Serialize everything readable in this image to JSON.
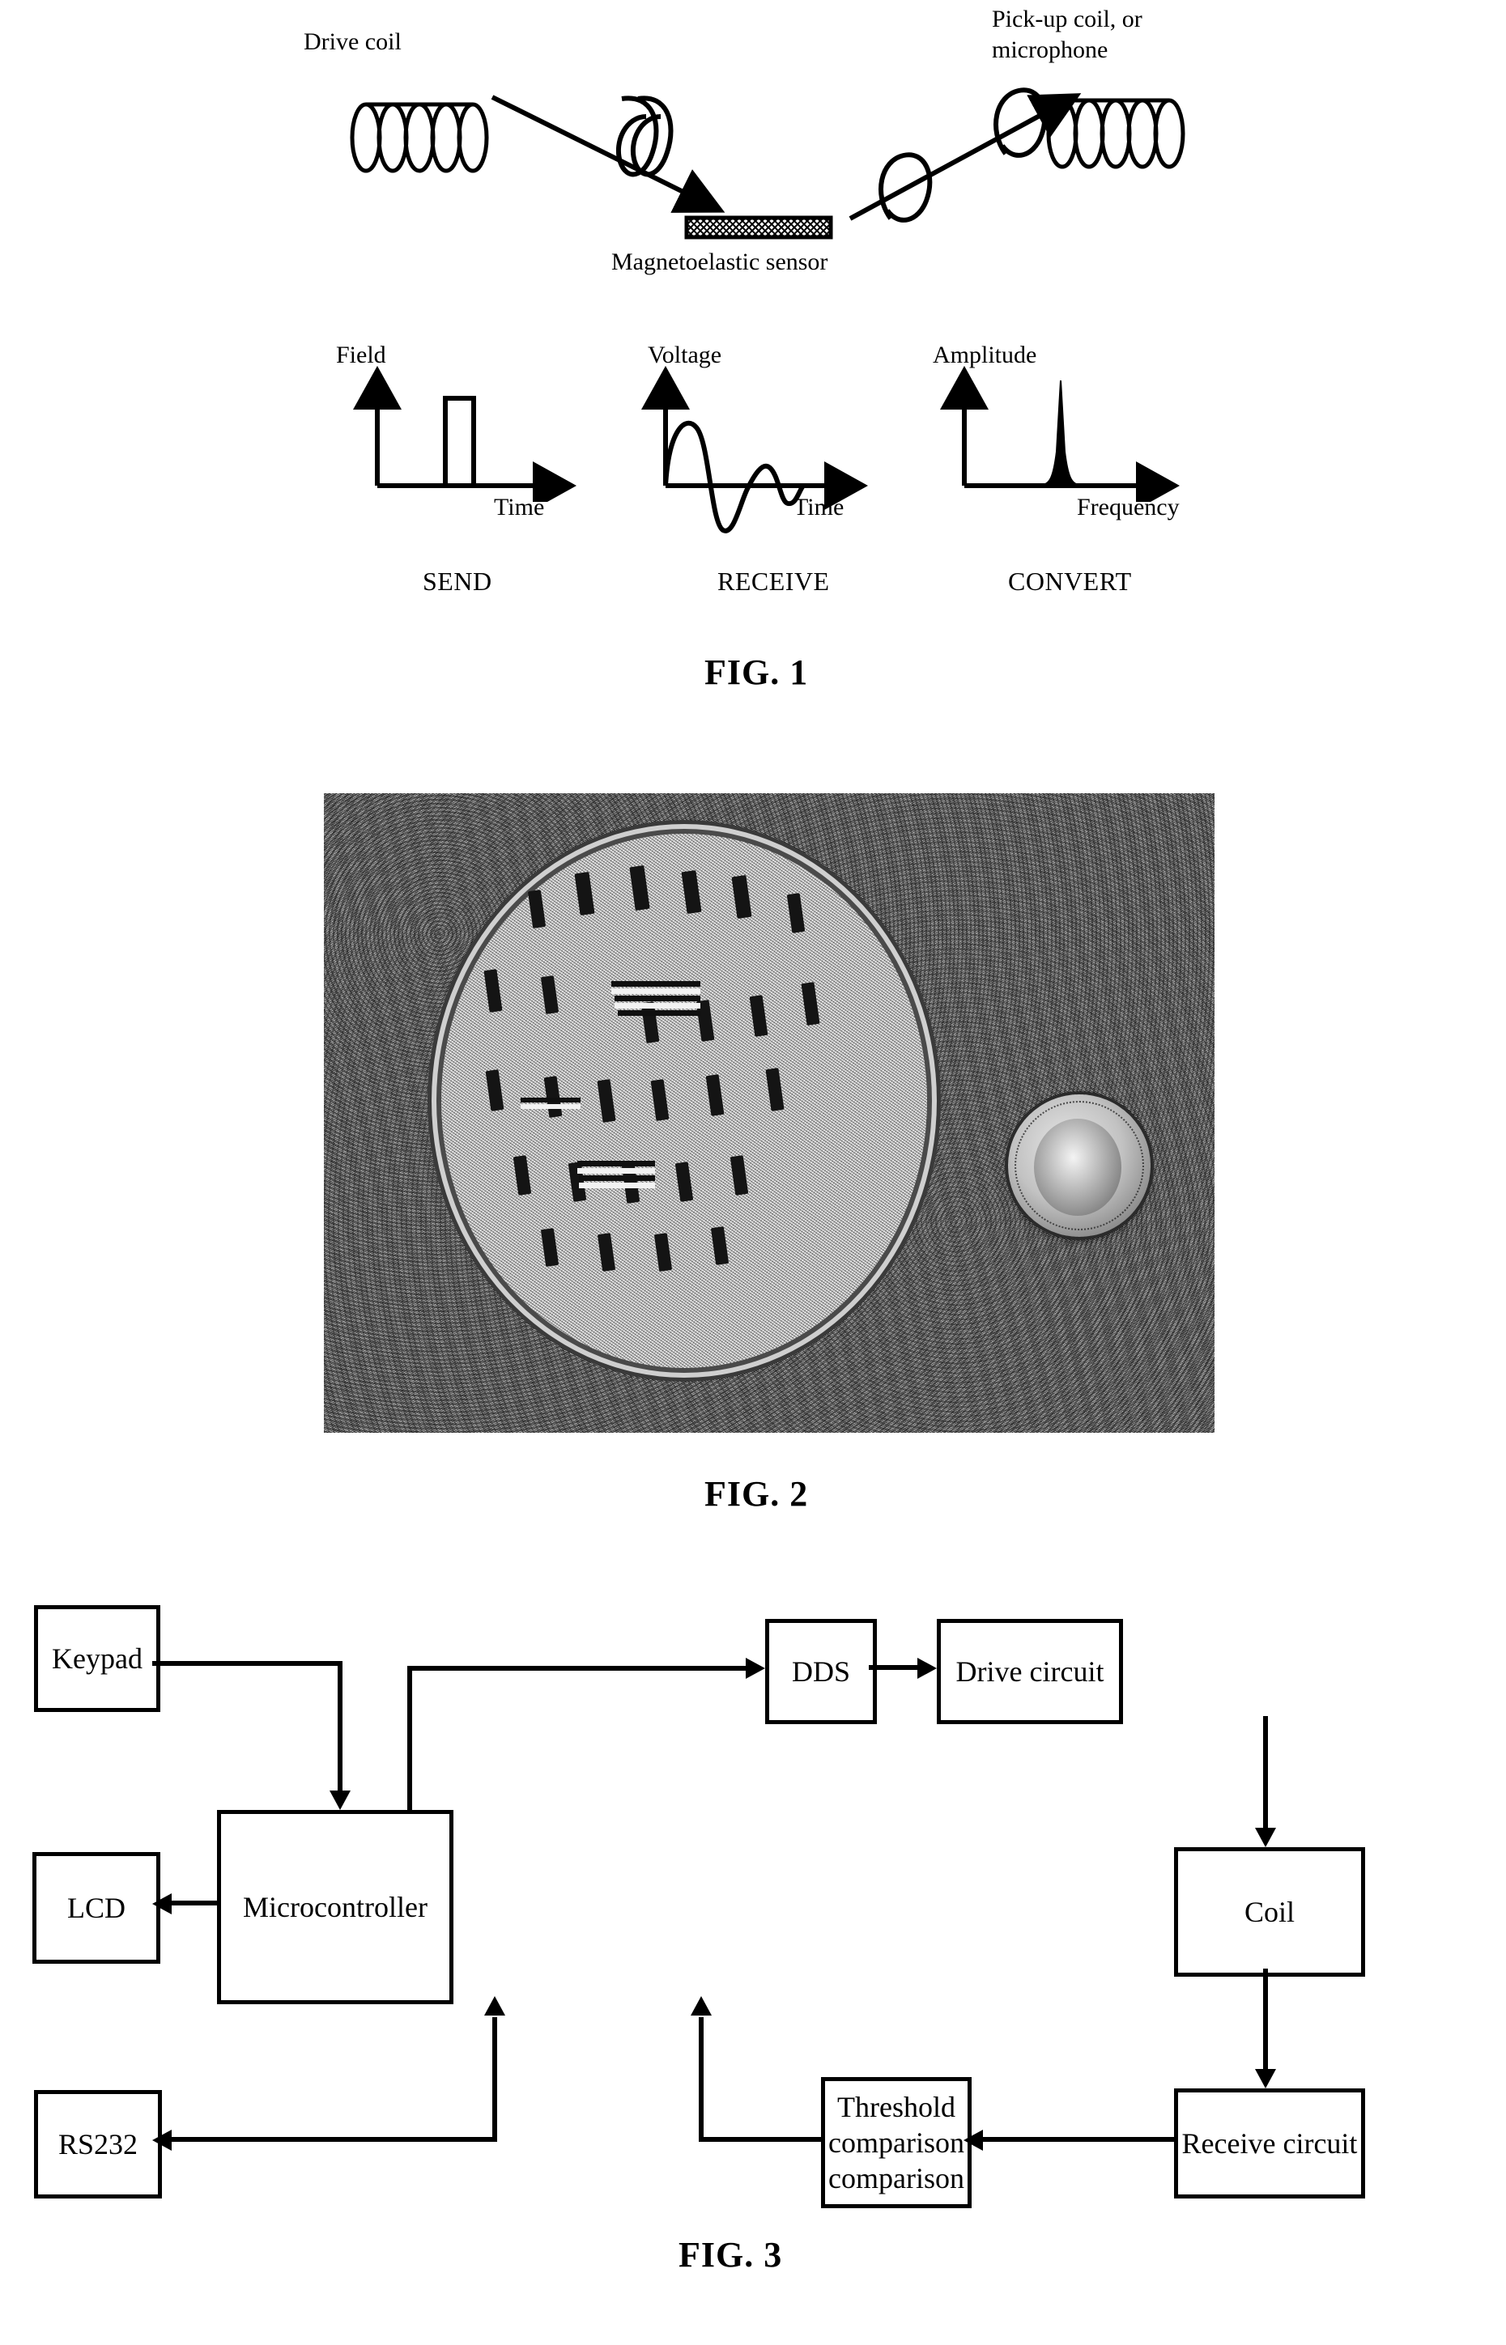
{
  "page": {
    "figures": [
      {
        "id": "fig1",
        "caption": "FIG. 1"
      },
      {
        "id": "fig2",
        "caption": "FIG. 2"
      },
      {
        "id": "fig3",
        "caption": "FIG. 3"
      }
    ]
  },
  "fig1": {
    "caption": "FIG. 1",
    "drive_coil_label": "Drive coil",
    "pickup_coil_label_line1": "Pick-up coil, or",
    "pickup_coil_label_line2": "microphone",
    "sensor_label": "Magnetoelastic sensor",
    "plots": [
      {
        "stage": "SEND",
        "ylabel": "Field",
        "xlabel": "Time",
        "waveform": "single-rectangular-pulse"
      },
      {
        "stage": "RECEIVE",
        "ylabel": "Voltage",
        "xlabel": "Time",
        "waveform": "damped-sinusoid"
      },
      {
        "stage": "CONVERT",
        "ylabel": "Amplitude",
        "xlabel": "Frequency",
        "waveform": "single-resonance-peak"
      }
    ]
  },
  "fig2": {
    "caption": "FIG. 2",
    "photo_description": "Petri dish containing magnetoelastic sensors next to a dime for scale"
  },
  "fig3": {
    "caption": "FIG. 3",
    "blocks": [
      {
        "id": "keypad",
        "label": "Keypad"
      },
      {
        "id": "dds",
        "label": "DDS"
      },
      {
        "id": "drive",
        "label": "Drive circuit"
      },
      {
        "id": "lcd",
        "label": "LCD"
      },
      {
        "id": "mcu",
        "label": "Microcontroller"
      },
      {
        "id": "coil",
        "label": "Coil"
      },
      {
        "id": "rs232",
        "label": "RS232"
      },
      {
        "id": "threshold",
        "label": "Threshold\ncomparison"
      },
      {
        "id": "threshold_line1",
        "label": "Threshold"
      },
      {
        "id": "threshold_line2",
        "label": "comparison"
      },
      {
        "id": "receive",
        "label": "Receive circuit"
      }
    ],
    "connections": [
      {
        "from": "keypad",
        "to": "mcu",
        "direction": "down"
      },
      {
        "from": "mcu",
        "to": "dds",
        "direction": "right"
      },
      {
        "from": "dds",
        "to": "drive",
        "direction": "right"
      },
      {
        "from": "drive",
        "to": "coil",
        "direction": "down"
      },
      {
        "from": "coil",
        "to": "receive",
        "direction": "down"
      },
      {
        "from": "receive",
        "to": "threshold",
        "direction": "left"
      },
      {
        "from": "threshold",
        "to": "mcu",
        "direction": "up"
      },
      {
        "from": "mcu",
        "to": "lcd",
        "direction": "left"
      },
      {
        "from": "mcu",
        "to": "rs232",
        "direction": "left"
      }
    ]
  },
  "colors": {
    "ink": "#000000",
    "paper": "#ffffff"
  }
}
